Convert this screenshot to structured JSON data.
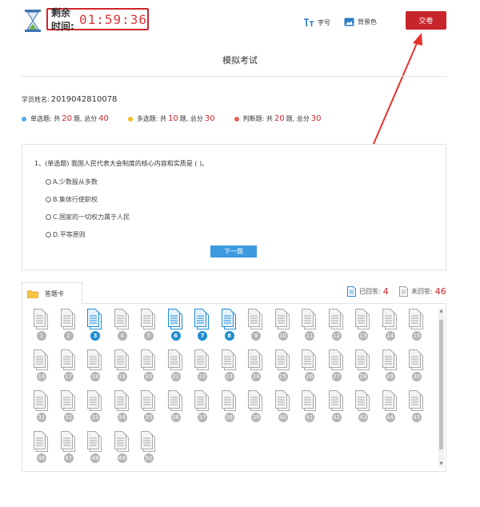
{
  "header": {
    "timer_label": "剩余时间:",
    "timer_value": "01:59:36",
    "font_size_label": "字号",
    "background_label": "背景色",
    "submit_label": "交卷"
  },
  "exam": {
    "title": "模拟考试",
    "student_label": "学员姓名:",
    "student_id": "2019042810078"
  },
  "stats": [
    {
      "label": "单选题: 共",
      "count": "20",
      "unit": "题, 总分",
      "score": "40",
      "color": "#5aa8e0"
    },
    {
      "label": "多选题: 共",
      "count": "10",
      "unit": "题, 总分",
      "score": "30",
      "color": "#f3c021"
    },
    {
      "label": "判断题: 共",
      "count": "20",
      "unit": "题, 总分",
      "score": "30",
      "color": "#e4605e"
    }
  ],
  "question": {
    "text": "1、(单选题) 我国人民代表大会制度的核心内容和实质是 ( )。",
    "options": [
      "A.少数服从多数",
      "B.集体行使职权",
      "C.国家的一切权力属于人民",
      "D.平等原则"
    ],
    "next_label": "下一题"
  },
  "answer_card": {
    "tab_label": "答题卡",
    "answered_label": "已回答:",
    "answered_count": "4",
    "unanswered_label": "未回答:",
    "unanswered_count": "46",
    "total": 50,
    "answered": [
      3,
      6,
      7,
      8
    ]
  },
  "colors": {
    "accent_red": "#c6252b",
    "answered_blue": "#1e8dd0",
    "button_blue": "#3c9ae0"
  }
}
